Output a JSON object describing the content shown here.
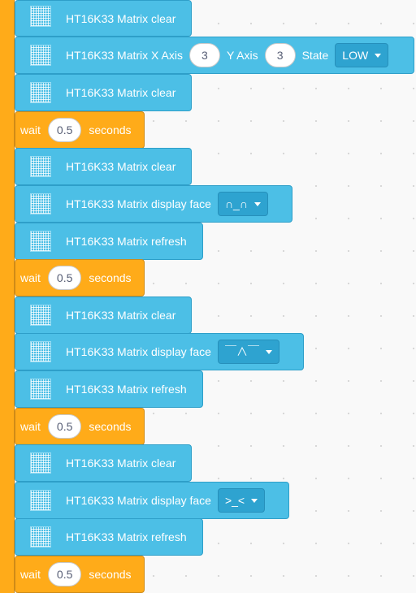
{
  "blocks": {
    "clear_label": "HT16K33 Matrix clear",
    "refresh_label": "HT16K33 Matrix refresh",
    "face_label": "HT16K33 Matrix display face",
    "xaxis_label": "HT16K33 Matrix X Axis",
    "yaxis_label": "Y Axis",
    "state_label": "State",
    "x_value": "3",
    "y_value": "3",
    "state_value": "LOW",
    "wait_label": "wait",
    "seconds_label": "seconds",
    "wait_value": "0.5",
    "faces": [
      "∩_∩",
      "￣∧￣",
      ">_<"
    ]
  },
  "colors": {
    "extension_block": "#4CBFE6",
    "control_block": "#FFAB19",
    "dropdown": "#2EA3D0"
  }
}
